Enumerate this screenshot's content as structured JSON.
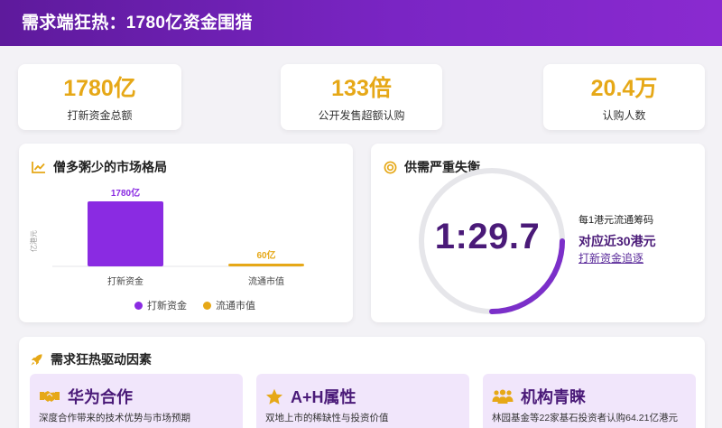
{
  "header": {
    "title": "需求端狂热：1780亿资金围猎"
  },
  "stats": [
    {
      "value": "1780亿",
      "label": "打新资金总额"
    },
    {
      "value": "133倍",
      "label": "公开发售超额认购"
    },
    {
      "value": "20.4万",
      "label": "认购人数"
    }
  ],
  "market_panel": {
    "title": "僧多粥少的市场格局",
    "icon": "line-chart-icon"
  },
  "chart_data": {
    "type": "bar",
    "categories": [
      "打新资金",
      "流通市值"
    ],
    "values": [
      1780,
      60
    ],
    "data_labels": [
      "1780亿",
      "60亿"
    ],
    "ylabel": "亿港元",
    "ylim": [
      0,
      2000
    ],
    "grid": false,
    "legend": [
      {
        "name": "打新资金",
        "color": "#8a2be2"
      },
      {
        "name": "流通市值",
        "color": "#e6a817"
      }
    ],
    "legend_position": "bottom",
    "bar_colors": [
      "#8a2be2",
      "#e6a817"
    ]
  },
  "supply_panel": {
    "title": "供需严重失衡",
    "icon": "target-icon",
    "ratio": "1:29.7",
    "ring_fill": 0.25,
    "line1": "每1港元流通筹码",
    "line2": "对应近30港元",
    "line3": "打新资金追逐",
    "colors": {
      "ring_bg": "#e6e6ea",
      "ring_fg": "#7b2fc9"
    }
  },
  "drivers": {
    "title": "需求狂热驱动因素",
    "icon": "rocket-icon",
    "cards": [
      {
        "title": "华为合作",
        "icon": "handshake-icon",
        "desc": "深度合作带来的技术优势与市场预期"
      },
      {
        "title": "A+H属性",
        "icon": "star-icon",
        "desc": "双地上市的稀缺性与投资价值"
      },
      {
        "title": "机构青睐",
        "icon": "users-icon",
        "desc": "林园基金等22家基石投资者认购64.21亿港元"
      }
    ]
  },
  "colors": {
    "accent": "#e6a817",
    "brand": "#7a25c4",
    "dark_purple": "#4a1a78"
  }
}
